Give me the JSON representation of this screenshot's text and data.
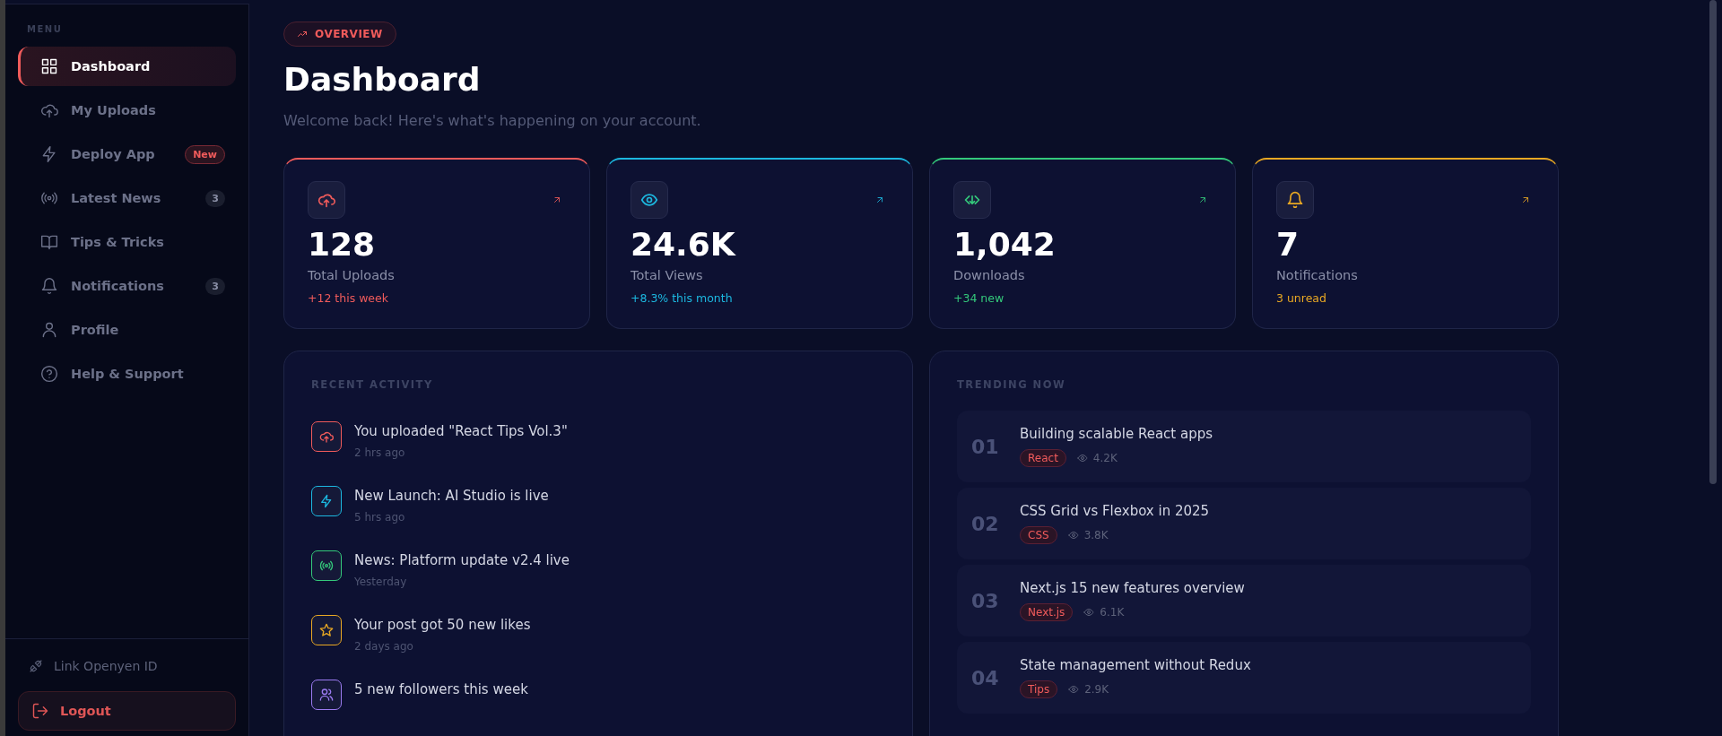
{
  "sidebar": {
    "section_label": "MENU",
    "items": [
      {
        "label": "Dashboard",
        "selected": true
      },
      {
        "label": "My Uploads",
        "selected": false
      },
      {
        "label": "Deploy App",
        "selected": false,
        "badge": {
          "text": "New",
          "kind": "new"
        }
      },
      {
        "label": "Latest News",
        "selected": false,
        "badge": {
          "text": "3",
          "kind": "count"
        }
      },
      {
        "label": "Tips & Tricks",
        "selected": false
      },
      {
        "label": "Notifications",
        "selected": false,
        "badge": {
          "text": "3",
          "kind": "count"
        }
      },
      {
        "label": "Profile",
        "selected": false
      },
      {
        "label": "Help & Support",
        "selected": false
      }
    ],
    "link_account": "Link Openyen ID",
    "logout": "Logout"
  },
  "header": {
    "pill": "OVERVIEW",
    "title": "Dashboard",
    "subtitle": "Welcome back! Here's what's happening on your account."
  },
  "stats": [
    {
      "value": "128",
      "label": "Total Uploads",
      "change": "+12 this week",
      "color": "#f05b5b"
    },
    {
      "value": "24.6K",
      "label": "Total Views",
      "change": "+8.3% this month",
      "color": "#1cb8e0"
    },
    {
      "value": "1,042",
      "label": "Downloads",
      "change": "+34 new",
      "color": "#34c97b"
    },
    {
      "value": "7",
      "label": "Notifications",
      "change": "3 unread",
      "color": "#e9a823"
    }
  ],
  "recent_activity": {
    "title": "RECENT ACTIVITY",
    "items": [
      {
        "text": "You uploaded \"React Tips Vol.3\"",
        "time": "2 hrs ago",
        "color": "#f05b5b"
      },
      {
        "text": "New Launch: AI Studio is live",
        "time": "5 hrs ago",
        "color": "#1cb8e0"
      },
      {
        "text": "News: Platform update v2.4 live",
        "time": "Yesterday",
        "color": "#34c97b"
      },
      {
        "text": "Your post got 50 new likes",
        "time": "2 days ago",
        "color": "#e9a823"
      },
      {
        "text": "5 new followers this week",
        "color": "#9b7bf0"
      }
    ]
  },
  "trending": {
    "title": "TRENDING NOW",
    "items": [
      {
        "rank": "01",
        "title": "Building scalable React apps",
        "tag": "React",
        "views": "4.2K"
      },
      {
        "rank": "02",
        "title": "CSS Grid vs Flexbox in 2025",
        "tag": "CSS",
        "views": "3.8K"
      },
      {
        "rank": "03",
        "title": "Next.js 15 new features overview",
        "tag": "Next.js",
        "views": "6.1K"
      },
      {
        "rank": "04",
        "title": "State management without Redux",
        "tag": "Tips",
        "views": "2.9K"
      }
    ]
  }
}
